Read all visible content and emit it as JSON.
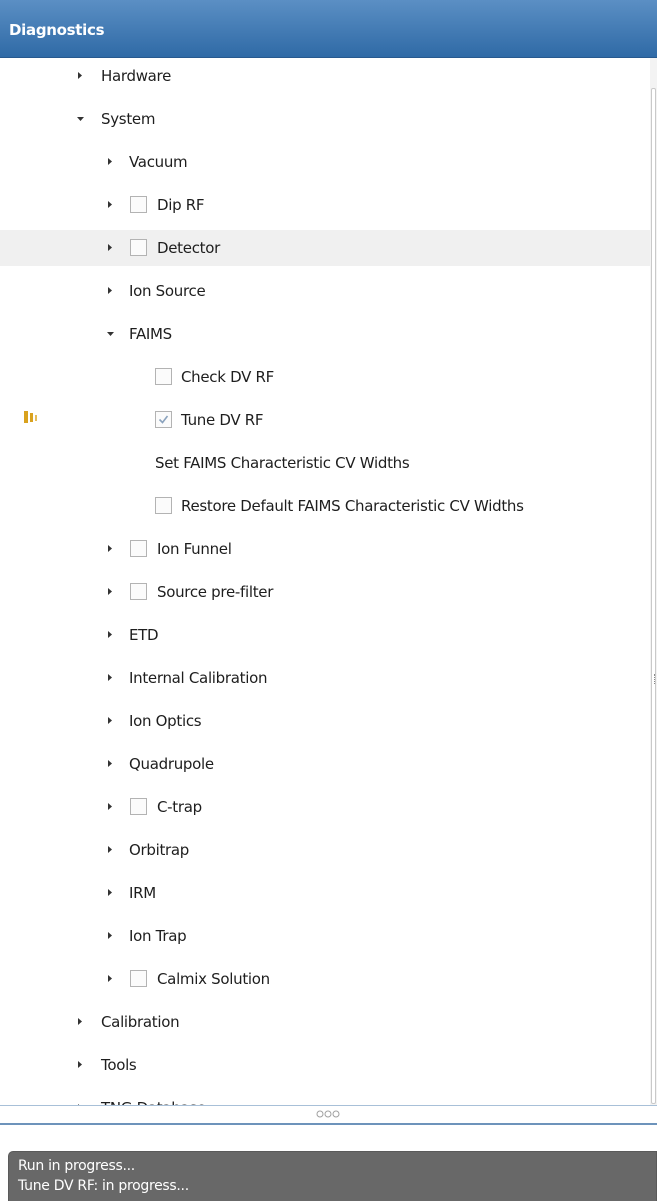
{
  "header": {
    "title": "Diagnostics"
  },
  "tree": [
    {
      "label": "Hardware",
      "arrow": "right",
      "checkbox": "none"
    },
    {
      "label": "System",
      "arrow": "down",
      "checkbox": "none"
    },
    {
      "label": "Vacuum",
      "arrow": "right",
      "checkbox": "none"
    },
    {
      "label": "Dip RF",
      "arrow": "right",
      "checkbox": "unchecked"
    },
    {
      "label": "Detector",
      "arrow": "right",
      "checkbox": "unchecked",
      "highlighted": true
    },
    {
      "label": "Ion Source",
      "arrow": "right",
      "checkbox": "none"
    },
    {
      "label": "FAIMS",
      "arrow": "down",
      "checkbox": "none"
    },
    {
      "label": "Check DV RF",
      "arrow": "none",
      "checkbox": "unchecked"
    },
    {
      "label": "Tune DV RF",
      "arrow": "none",
      "checkbox": "checked",
      "running": true
    },
    {
      "label": "Set FAIMS Characteristic CV Widths",
      "arrow": "none",
      "checkbox": "none"
    },
    {
      "label": "Restore Default FAIMS Characteristic CV Widths",
      "arrow": "none",
      "checkbox": "unchecked"
    },
    {
      "label": "Ion Funnel",
      "arrow": "right",
      "checkbox": "unchecked"
    },
    {
      "label": "Source pre-filter",
      "arrow": "right",
      "checkbox": "unchecked"
    },
    {
      "label": "ETD",
      "arrow": "right",
      "checkbox": "none"
    },
    {
      "label": "Internal Calibration",
      "arrow": "right",
      "checkbox": "none"
    },
    {
      "label": "Ion Optics",
      "arrow": "right",
      "checkbox": "none"
    },
    {
      "label": "Quadrupole",
      "arrow": "right",
      "checkbox": "none"
    },
    {
      "label": "C-trap",
      "arrow": "right",
      "checkbox": "unchecked"
    },
    {
      "label": "Orbitrap",
      "arrow": "right",
      "checkbox": "none"
    },
    {
      "label": "IRM",
      "arrow": "right",
      "checkbox": "none"
    },
    {
      "label": "Ion Trap",
      "arrow": "right",
      "checkbox": "none"
    },
    {
      "label": "Calmix Solution",
      "arrow": "right",
      "checkbox": "unchecked"
    },
    {
      "label": "Calibration",
      "arrow": "right",
      "checkbox": "none"
    },
    {
      "label": "Tools",
      "arrow": "right",
      "checkbox": "none"
    },
    {
      "label": "TNG Database",
      "arrow": "right",
      "checkbox": "none"
    }
  ],
  "console": {
    "line1": "Run in progress...",
    "line2": "Tune DV RF: in progress..."
  },
  "colors": {
    "header_top": "#5b8fc4",
    "header_bottom": "#2f6aa6",
    "running_icon": "#d9a21f",
    "console_bg": "#686868"
  }
}
